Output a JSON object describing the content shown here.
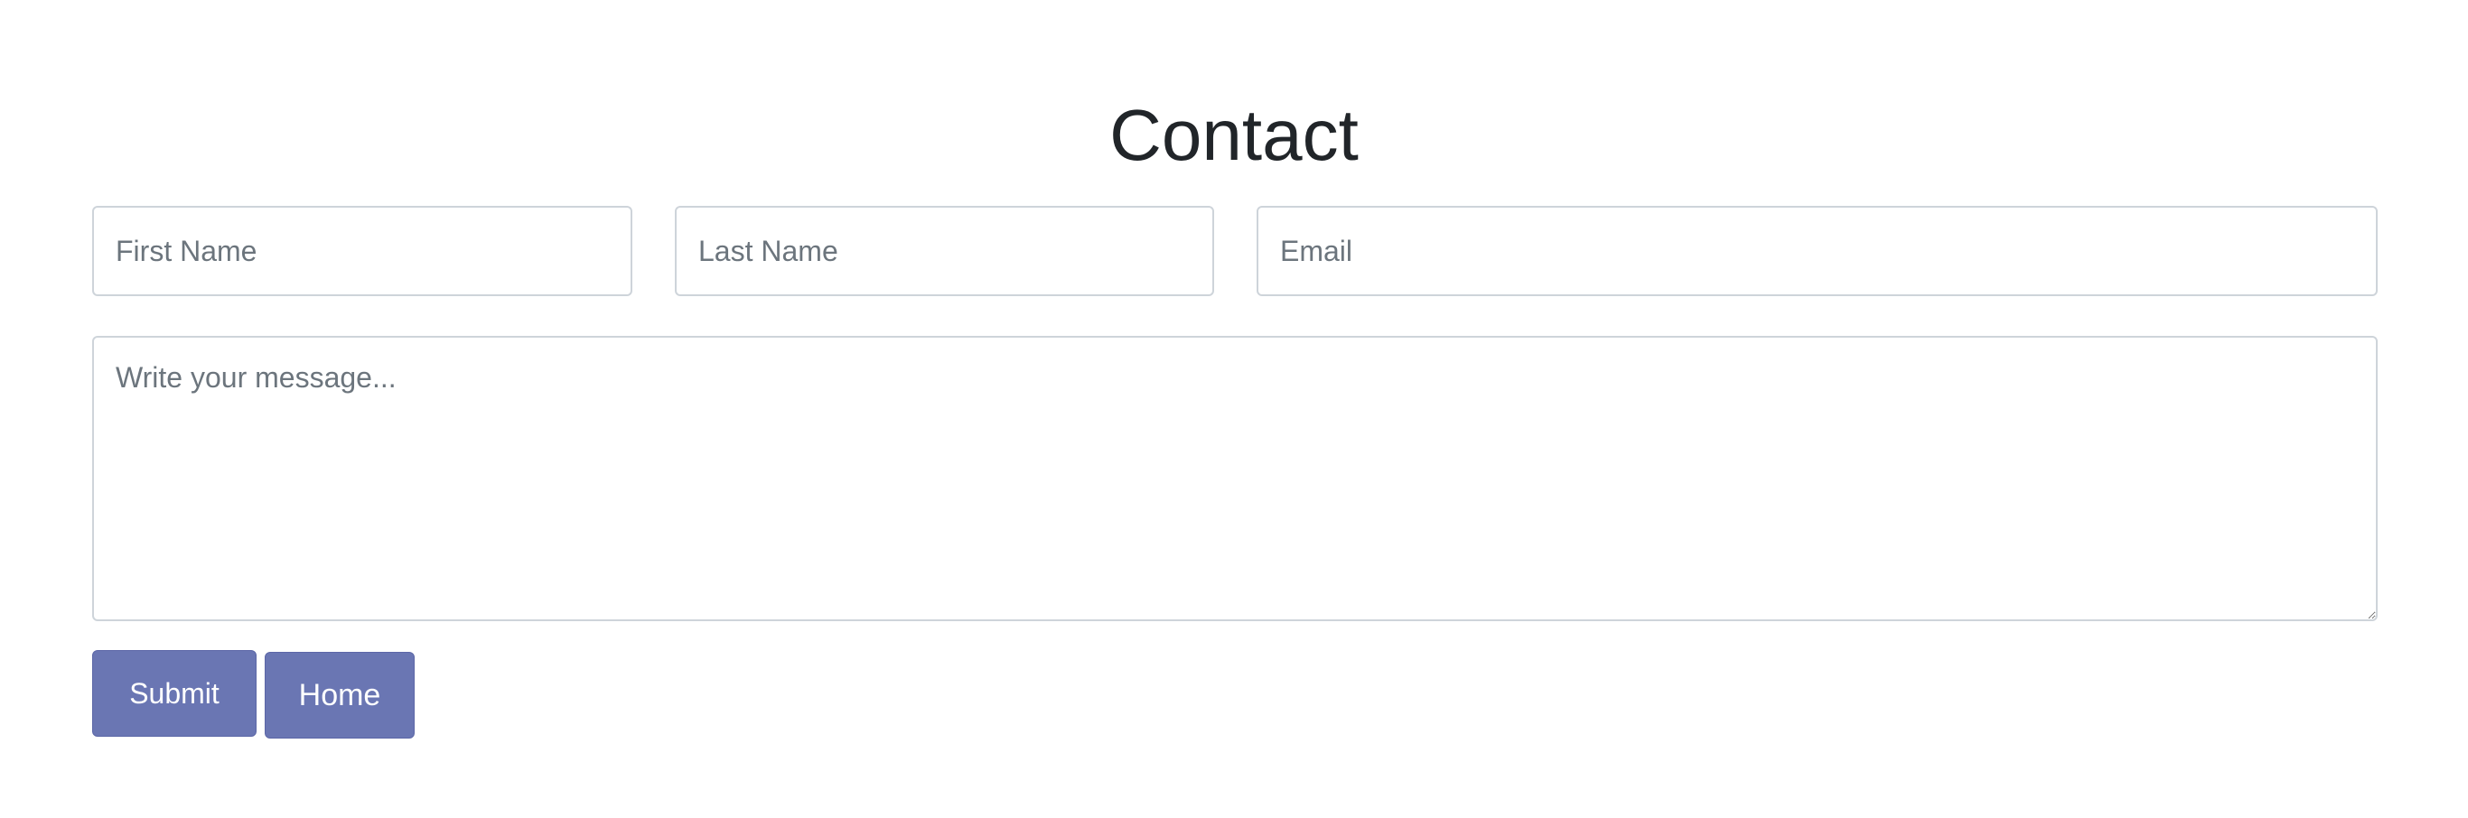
{
  "page": {
    "title": "Contact"
  },
  "form": {
    "first_name": {
      "placeholder": "First Name",
      "value": ""
    },
    "last_name": {
      "placeholder": "Last Name",
      "value": ""
    },
    "email": {
      "placeholder": "Email",
      "value": ""
    },
    "message": {
      "placeholder": "Write your message...",
      "value": ""
    }
  },
  "actions": {
    "submit_label": "Submit",
    "home_label": "Home"
  },
  "colors": {
    "button_bg": "#6a76b3",
    "button_text": "#ffffff",
    "title_text": "#212529",
    "field_border": "#ced4da",
    "placeholder_text": "#6c757d"
  }
}
